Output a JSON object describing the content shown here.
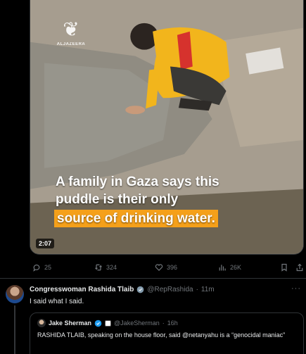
{
  "video": {
    "logo_text": "ALJAZEERA",
    "caption_line1": "A family in Gaza says this",
    "caption_line2": "puddle is their only",
    "caption_highlight": "source of drinking water.",
    "timestamp": "2:07",
    "highlight_color": "#f5a01a"
  },
  "actions": {
    "replies": "25",
    "reposts": "324",
    "likes": "396",
    "views": "26K"
  },
  "tweet": {
    "author_name": "Congresswoman Rashida Tlaib",
    "handle": "@RepRashida",
    "separator": "·",
    "time": "11m",
    "more": "···",
    "text": "I said what I said."
  },
  "quote": {
    "author_name": "Jake Sherman",
    "handle": "@JakeSherman",
    "separator": "·",
    "time": "16h",
    "text": "RASHIDA TLAIB, speaking on the house floor, said @netanyahu is a “genocidal maniac”"
  },
  "colors": {
    "background": "#000000",
    "text_primary": "#e7e9ea",
    "text_secondary": "#71767b",
    "border": "#2f3336",
    "verified_blue": "#1d9bf0"
  }
}
